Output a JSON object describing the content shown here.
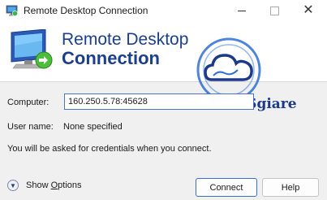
{
  "window": {
    "title": "Remote Desktop Connection"
  },
  "banner": {
    "line1": "Remote Desktop",
    "line2": "Connection"
  },
  "watermark": {
    "text": "MuaVPSgiare"
  },
  "form": {
    "computer_label": "Computer:",
    "computer_value": "160.250.5.78:45628",
    "user_label": "User name:",
    "user_value": "None specified",
    "credentials_message": "You will be asked for credentials when you connect."
  },
  "footer": {
    "show_options_prefix": "Show ",
    "show_options_underlined": "O",
    "show_options_suffix": "ptions",
    "connect_label": "Connect",
    "help_label": "Help"
  },
  "icons": {
    "app": "remote-desktop-icon",
    "options": "chevron-down-icon",
    "minimize": "minimize-icon",
    "maximize": "maximize-icon",
    "close": "close-icon"
  },
  "colors": {
    "brand_blue": "#1b3f8c",
    "focus_border": "#3a6fcf"
  }
}
